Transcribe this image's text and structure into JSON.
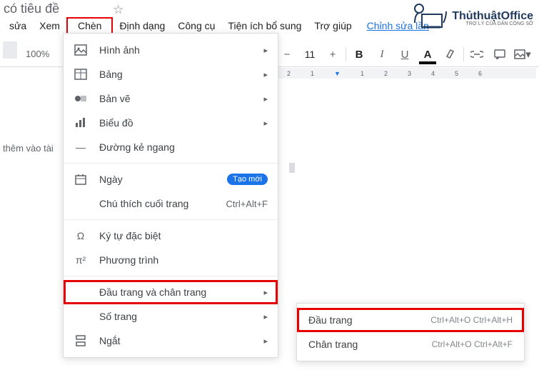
{
  "doc_title": "ông có tiêu đề",
  "menubar": {
    "edit": "sửa",
    "view": "Xem",
    "insert": "Chèn",
    "format": "Định dạng",
    "tools": "Công cụ",
    "addons": "Tiện ích bổ sung",
    "help": "Trợ giúp",
    "last_edit": "Chỉnh sửa lần"
  },
  "logo": {
    "text": "ThủthuậtOffice",
    "sub": "TRỢ LÝ CỦA DÂN CÔNG SỞ"
  },
  "toolbar": {
    "zoom": "100%",
    "font_size": "11"
  },
  "body_hint": "thêm vào tài",
  "ruler": [
    "2",
    "1",
    "1",
    "2",
    "3",
    "4",
    "5",
    "6"
  ],
  "menu": {
    "image": "Hình ảnh",
    "table": "Bảng",
    "drawing": "Bản vẽ",
    "chart": "Biểu đồ",
    "hr": "Đường kẻ ngang",
    "date": "Ngày",
    "date_badge": "Tạo mới",
    "footnote": "Chú thích cuối trang",
    "footnote_sc": "Ctrl+Alt+F",
    "special": "Ký tự đặc biệt",
    "equation": "Phương trình",
    "hf": "Đầu trang và chân trang",
    "pagenum": "Số trang",
    "break": "Ngắt"
  },
  "submenu": {
    "header": "Đầu trang",
    "header_sc": "Ctrl+Alt+O Ctrl+Alt+H",
    "footer": "Chân trang",
    "footer_sc": "Ctrl+Alt+O Ctrl+Alt+F"
  }
}
